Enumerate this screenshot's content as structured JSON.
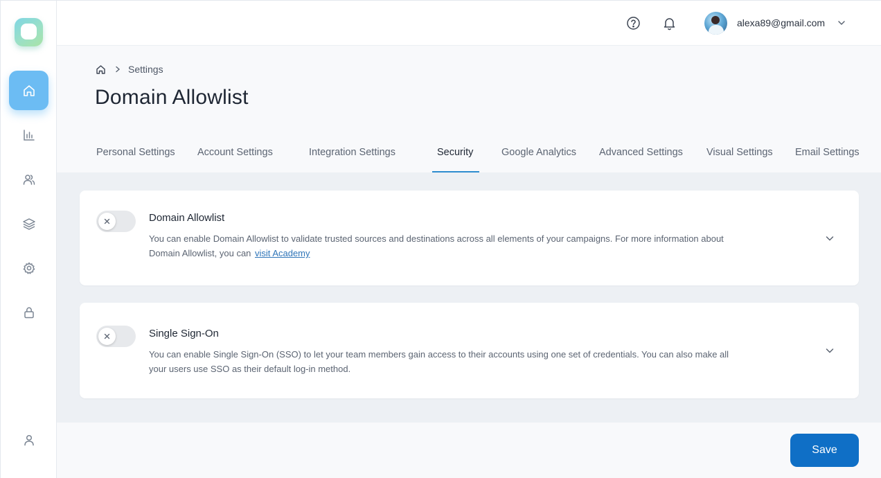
{
  "header": {
    "help_icon": "help-circle-icon",
    "notification_icon": "bell-icon",
    "user_email": "alexa89@gmail.com"
  },
  "sidebar": {
    "items": [
      {
        "icon": "home-icon",
        "active": true
      },
      {
        "icon": "bar-chart-icon",
        "active": false
      },
      {
        "icon": "users-icon",
        "active": false
      },
      {
        "icon": "layers-icon",
        "active": false
      },
      {
        "icon": "gear-icon",
        "active": false
      },
      {
        "icon": "lock-icon",
        "active": false
      }
    ],
    "bottom_icon": "user-icon"
  },
  "breadcrumb": {
    "home_icon": "home-icon",
    "current": "Settings"
  },
  "page": {
    "title": "Domain Allowlist"
  },
  "tabs": [
    {
      "label": "Personal Settings",
      "active": false
    },
    {
      "label": "Account Settings",
      "active": false
    },
    {
      "label": "Integration Settings",
      "active": false
    },
    {
      "label": "Security",
      "active": true
    },
    {
      "label": "Google Analytics",
      "active": false
    },
    {
      "label": "Advanced Settings",
      "active": false
    },
    {
      "label": "Visual Settings",
      "active": false
    },
    {
      "label": "Email Settings",
      "active": false
    }
  ],
  "cards": [
    {
      "title": "Domain Allowlist",
      "enabled": false,
      "desc_line1": "You can enable Domain Allowlist to validate trusted sources and destinations across all elements of your campaigns. For more information about",
      "desc_line2": "Domain Allowlist, you can",
      "link": "visit Academy"
    },
    {
      "title": "Single Sign-On",
      "enabled": false,
      "desc_line1": "You can enable Single Sign-On (SSO) to let your team members gain access to their accounts using one set of credentials. You can also make all",
      "desc_line2": "your users use SSO as their default log-in method."
    }
  ],
  "footer": {
    "save_label": "Save"
  },
  "colors": {
    "accent": "#2d8ccf",
    "save_button": "#0f6fc6",
    "active_nav": "#6cbcf3",
    "link": "#2d74b8"
  }
}
